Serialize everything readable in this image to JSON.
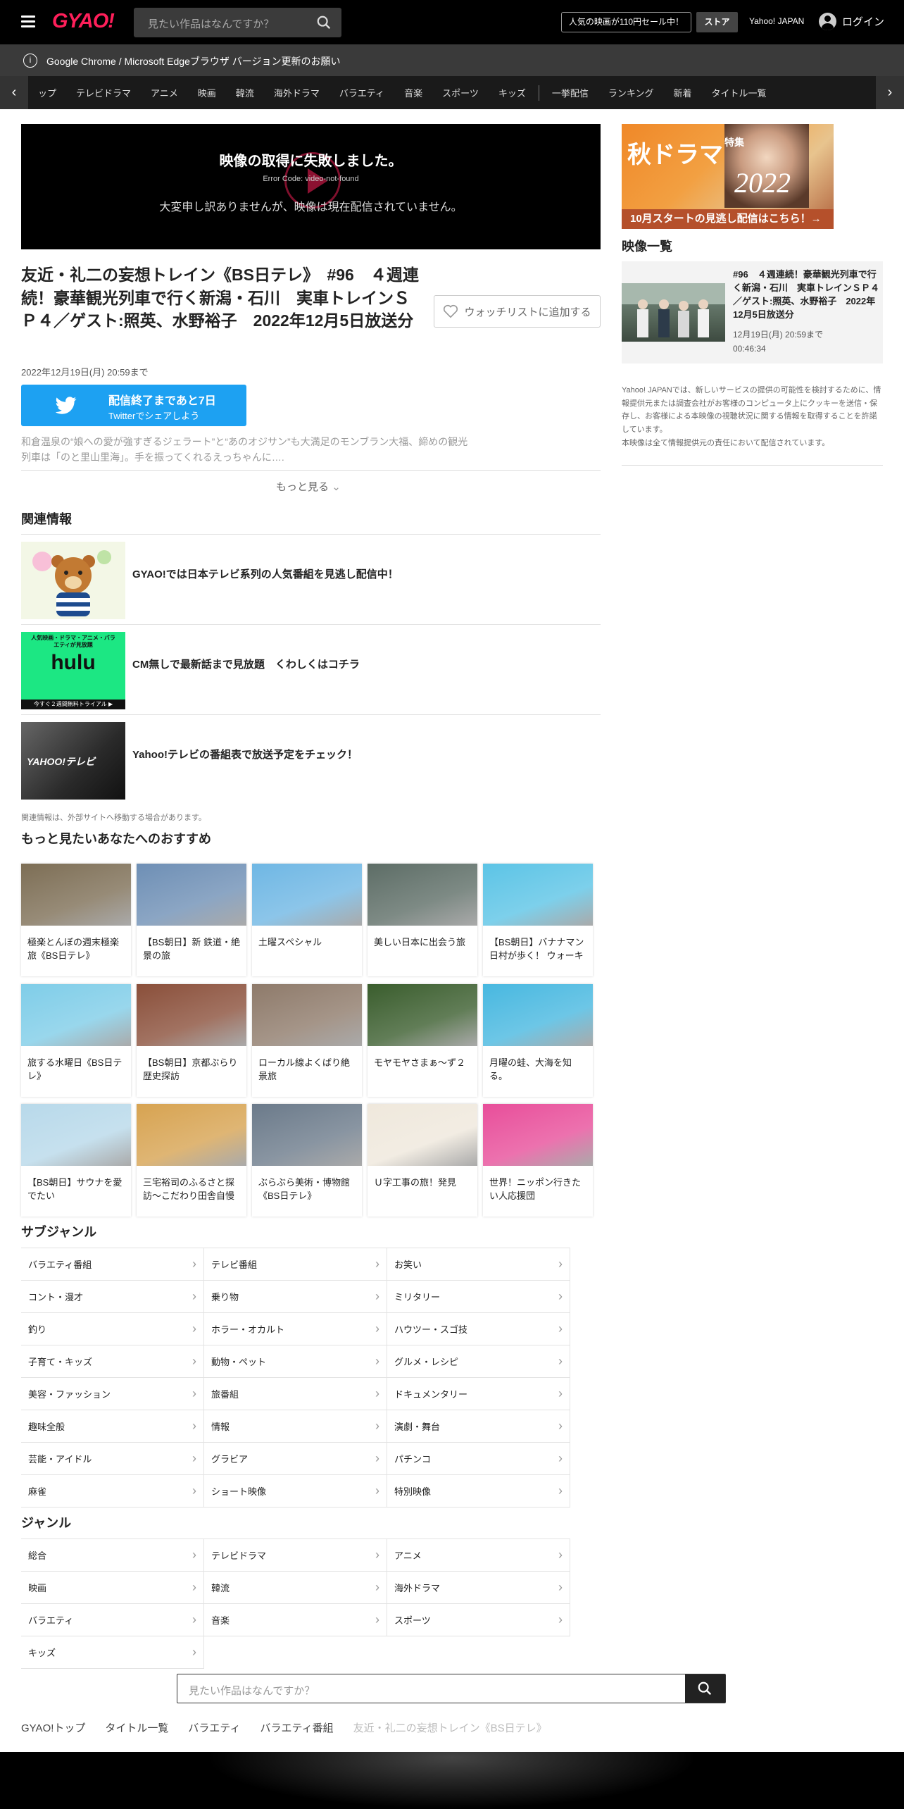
{
  "header": {
    "logo": "GYAO!",
    "search_placeholder": "見たい作品はなんですか？",
    "promo": "人気の映画が110円セール中！",
    "store": "ストア",
    "yahoo_japan": "Yahoo! JAPAN",
    "login": "ログイン"
  },
  "notice": "Google Chrome / Microsoft Edgeブラウザ バージョン更新のお願い",
  "nav": {
    "items": [
      "ップ",
      "テレビドラマ",
      "アニメ",
      "映画",
      "韓流",
      "海外ドラマ",
      "バラエティ",
      "音楽",
      "スポーツ",
      "キッズ"
    ],
    "items2": [
      "一挙配信",
      "ランキング",
      "新着",
      "タイトル一覧"
    ]
  },
  "player": {
    "error_title": "映像の取得に失敗しました。",
    "error_code": "Error Code: video-not-found",
    "error_msg": "大変申し訳ありませんが、映像は現在配信されていません。"
  },
  "episode": {
    "title": "友近・礼二の妄想トレイン《BS日テレ》　#96　４週連続！豪華観光列車で行く新潟・石川　実車トレインＳＰ４／ゲスト:照英、水野裕子　2022年12月5日放送分",
    "watchlist": "ウォッチリストに追加する",
    "date": "2022年12月19日(月) 20:59まで",
    "twitter_line1": "配信終了まであと7日",
    "twitter_line2": "Twitterでシェアしよう",
    "description": "和倉温泉の“娘への愛が強すぎるジェラート”と“あのオジサン”も大満足のモンブラン大福、締めの観光列車は「のと里山里海」。手を振ってくれるえっちゃんに….",
    "more": "もっと見る"
  },
  "related": {
    "heading": "関連情報",
    "items": [
      {
        "text": "GYAO!では日本テレビ系列の人気番組を見逃し配信中！"
      },
      {
        "text": "CM無しで最新話まで見放題　くわしくはコチラ",
        "thumb_top": "人気映画・ドラマ・アニメ・バラエティが見放題",
        "thumb_logo": "hulu",
        "thumb_bottom": "今すぐ２週間無料トライアル ▶"
      },
      {
        "text": "Yahoo!テレビの番組表で放送予定をチェック！",
        "thumb_logo": "YAHOO!テレビ"
      }
    ],
    "note": "関連情報は、外部サイトへ移動する場合があります。"
  },
  "recommend": {
    "heading": "もっと見たいあなたへのおすすめ",
    "cards": [
      {
        "title": "極楽とんぼの週末極楽旅《BS日テレ》",
        "color": "#7d6e55"
      },
      {
        "title": "【BS朝日】新 鉄道・絶景の旅",
        "color": "#6e8fb5"
      },
      {
        "title": "土曜スペシャル",
        "color": "#6fb7e4"
      },
      {
        "title": "美しい日本に出会う旅",
        "color": "#5d6d66"
      },
      {
        "title": "【BS朝日】バナナマン日村が歩く！ ウォーキ",
        "color": "#5cc4e6"
      },
      {
        "title": "旅する水曜日《BS日テレ》",
        "color": "#7fcde8"
      },
      {
        "title": "【BS朝日】京都ぶらり歴史探訪",
        "color": "#8a4f3a"
      },
      {
        "title": "ローカル線よくばり絶景旅",
        "color": "#8e7a6a"
      },
      {
        "title": "モヤモヤさまぁ～ず２",
        "color": "#3a5d2d"
      },
      {
        "title": "月曜の蛙、大海を知る。",
        "color": "#48b8e0"
      },
      {
        "title": "【BS朝日】サウナを愛でたい",
        "color": "#b8d9ea"
      },
      {
        "title": "三宅裕司のふるさと探訪～こだわり田舎自慢",
        "color": "#d7a351"
      },
      {
        "title": "ぶらぶら美術・博物館《BS日テレ》",
        "color": "#6b7a8a"
      },
      {
        "title": "Ｕ字工事の旅！発見",
        "color": "#efe8dc"
      },
      {
        "title": "世界！ニッポン行きたい人応援団",
        "color": "#e84e9a"
      }
    ]
  },
  "subgenre": {
    "heading": "サブジャンル",
    "items": [
      "バラエティ番組",
      "テレビ番組",
      "お笑い",
      "コント・漫才",
      "乗り物",
      "ミリタリー",
      "釣り",
      "ホラー・オカルト",
      "ハウツー・スゴ技",
      "子育て・キッズ",
      "動物・ペット",
      "グルメ・レシピ",
      "美容・ファッション",
      "旅番組",
      "ドキュメンタリー",
      "趣味全般",
      "情報",
      "演劇・舞台",
      "芸能・アイドル",
      "グラビア",
      "パチンコ",
      "麻雀",
      "ショート映像",
      "特別映像"
    ]
  },
  "genre": {
    "heading": "ジャンル",
    "items": [
      "総合",
      "テレビドラマ",
      "アニメ",
      "映画",
      "韓流",
      "海外ドラマ",
      "バラエティ",
      "音楽",
      "スポーツ",
      "キッズ"
    ]
  },
  "footer": {
    "search_placeholder": "見たい作品はなんですか？",
    "breadcrumb": [
      "GYAO!トップ",
      "タイトル一覧",
      "バラエティ",
      "バラエティ番組",
      "友近・礼二の妄想トレイン《BS日テレ》"
    ]
  },
  "sidebar": {
    "ad_title": "秋ドラマ",
    "ad_sub": "特集",
    "ad_year": "2022",
    "ad_banner": "10月スタートの見逃し配信はこちら！→",
    "list_heading": "映像一覧",
    "video_title": "#96　４週連続！豪華観光列車で行く新潟・石川　実車トレインＳＰ４／ゲスト:照英、水野裕子　2022年12月5日放送分",
    "video_date": "12月19日(月) 20:59まで",
    "video_duration": "00:46:34",
    "note": "Yahoo! JAPANでは、新しいサービスの提供の可能性を検討するために、情報提供元または調査会社がお客様のコンピュータ上にクッキーを送信・保存し、お客様による本映像の視聴状況に関する情報を取得することを許諾しています。\n本映像は全て情報提供元の責任において配信されています。"
  },
  "colors": {
    "accent": "#ff1f5a",
    "twitter": "#1da1f2",
    "hulu": "#1ce783"
  }
}
